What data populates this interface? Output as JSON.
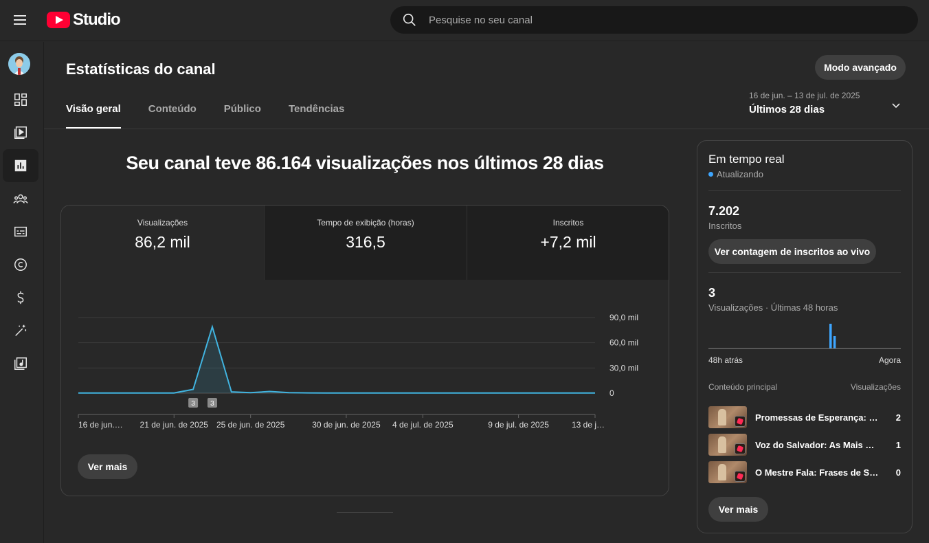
{
  "app": {
    "logo_text": "Studio"
  },
  "search": {
    "placeholder": "Pesquise no seu canal"
  },
  "sidebar": {
    "items": [
      {
        "name": "dashboard",
        "icon": "dashboard-icon"
      },
      {
        "name": "content",
        "icon": "video-icon"
      },
      {
        "name": "analytics",
        "icon": "analytics-icon",
        "active": true
      },
      {
        "name": "community",
        "icon": "people-icon"
      },
      {
        "name": "subtitles",
        "icon": "subtitles-icon"
      },
      {
        "name": "copyright",
        "icon": "copyright-icon"
      },
      {
        "name": "earn",
        "icon": "dollar-icon"
      },
      {
        "name": "customization",
        "icon": "magic-wand-icon"
      },
      {
        "name": "audio-library",
        "icon": "music-library-icon"
      }
    ]
  },
  "header": {
    "title": "Estatísticas do canal",
    "advanced_mode": "Modo avançado",
    "tabs": [
      "Visão geral",
      "Conteúdo",
      "Público",
      "Tendências"
    ],
    "date_range_sub": "16 de jun. – 13 de jul. de 2025",
    "date_range_main": "Últimos 28 dias"
  },
  "overview": {
    "headline": "Seu canal teve 86.164 visualizações nos últimos 28 dias",
    "metrics": [
      {
        "label": "Visualizações",
        "value": "86,2 mil"
      },
      {
        "label": "Tempo de exibição (horas)",
        "value": "316,5"
      },
      {
        "label": "Inscritos",
        "value": "+7,2 mil"
      }
    ],
    "see_more": "Ver mais"
  },
  "chart_data": {
    "type": "area",
    "x": [
      "16 de jun.",
      "17 de jun.",
      "18 de jun.",
      "19 de jun.",
      "20 de jun.",
      "21 de jun.",
      "22 de jun.",
      "23 de jun.",
      "24 de jun.",
      "25 de jun.",
      "26 de jun.",
      "27 de jun.",
      "28 de jun.",
      "29 de jun.",
      "30 de jun.",
      "1 de jul.",
      "2 de jul.",
      "3 de jul.",
      "4 de jul.",
      "5 de jul.",
      "6 de jul.",
      "7 de jul.",
      "8 de jul.",
      "9 de jul.",
      "10 de jul.",
      "11 de jul.",
      "12 de jul.",
      "13 de jul."
    ],
    "series": [
      {
        "values": [
          200,
          200,
          200,
          200,
          200,
          250,
          4500,
          79000,
          1500,
          600,
          2000,
          600,
          300,
          250,
          200,
          200,
          200,
          200,
          200,
          200,
          200,
          200,
          200,
          200,
          200,
          200,
          200,
          200
        ]
      }
    ],
    "x_tick_labels": [
      "16 de jun.…",
      "21 de jun. de 2025",
      "25 de jun. de 2025",
      "30 de jun. de 2025",
      "4 de jul. de 2025",
      "9 de jul. de 2025",
      "13 de j…"
    ],
    "x_tick_indices": [
      0,
      5,
      9,
      14,
      18,
      23,
      27
    ],
    "y_ticks": [
      {
        "v": 0,
        "label": "0"
      },
      {
        "v": 30000,
        "label": "30,0 mil"
      },
      {
        "v": 60000,
        "label": "60,0 mil"
      },
      {
        "v": 90000,
        "label": "90,0 mil"
      }
    ],
    "ylim": [
      0,
      90000
    ],
    "markers": [
      {
        "index": 6,
        "label": "3"
      },
      {
        "index": 7,
        "label": "3"
      }
    ],
    "line_color": "#41b4e0",
    "grid": true
  },
  "realtime": {
    "title": "Em tempo real",
    "status": "Atualizando",
    "subscribers_value": "7.202",
    "subscribers_label": "Inscritos",
    "live_count_button": "Ver contagem de inscritos ao vivo",
    "views_value": "3",
    "views_label": "Visualizações · Últimas 48 horas",
    "axis_left": "48h atrás",
    "axis_right": "Agora",
    "mini_chart_data": {
      "type": "bar",
      "bars": [
        {
          "hour_index": 30,
          "value": 2
        },
        {
          "hour_index": 31,
          "value": 1
        }
      ],
      "total_hours": 48,
      "bar_color": "#3ea6ff"
    },
    "top_content_label": "Conteúdo principal",
    "top_content_metric": "Visualizações",
    "top_content": [
      {
        "title": "Promessas de Esperança: Frases",
        "views": "2"
      },
      {
        "title": "Voz do Salvador: As Mais Belas",
        "views": "1"
      },
      {
        "title": "O Mestre Fala: Frases de Sabedoria",
        "views": "0"
      }
    ],
    "see_more": "Ver mais"
  }
}
